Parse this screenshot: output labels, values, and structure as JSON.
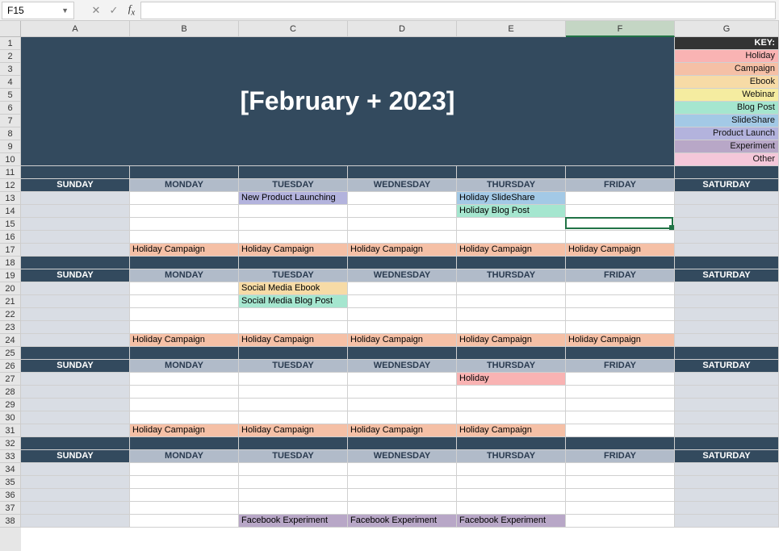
{
  "name_box": "F15",
  "formula_value": "",
  "title": "[February + 2023]",
  "columns": [
    "A",
    "B",
    "C",
    "D",
    "E",
    "F",
    "G"
  ],
  "active_col": "F",
  "row_count": 38,
  "key_header": "KEY:",
  "key_items": [
    {
      "label": "Holiday",
      "cls": "c-holiday"
    },
    {
      "label": "Campaign",
      "cls": "c-campaign"
    },
    {
      "label": "Ebook",
      "cls": "c-ebook"
    },
    {
      "label": "Webinar",
      "cls": "c-webinar"
    },
    {
      "label": "Blog Post",
      "cls": "c-blogpost"
    },
    {
      "label": "SlideShare",
      "cls": "c-slideshare"
    },
    {
      "label": "Product Launch",
      "cls": "c-prodlaunch"
    },
    {
      "label": "Experiment",
      "cls": "c-experiment"
    },
    {
      "label": "Other",
      "cls": "c-other"
    }
  ],
  "days": [
    "SUNDAY",
    "MONDAY",
    "TUESDAY",
    "WEDNESDAY",
    "THURSDAY",
    "FRIDAY",
    "SATURDAY"
  ],
  "weeks": [
    {
      "day_row": 12,
      "body_start": 13,
      "body_end": 17,
      "entries": [
        {
          "row": 13,
          "col": "C",
          "text": "New Product Launching",
          "cls": "c-prodlaunch"
        },
        {
          "row": 13,
          "col": "E",
          "text": "Holiday SlideShare",
          "cls": "c-slideshare"
        },
        {
          "row": 14,
          "col": "E",
          "text": "Holiday Blog Post",
          "cls": "c-blogpost"
        },
        {
          "row": 17,
          "col": "B",
          "text": "Holiday Campaign",
          "cls": "c-campaign"
        },
        {
          "row": 17,
          "col": "C",
          "text": "Holiday Campaign",
          "cls": "c-campaign"
        },
        {
          "row": 17,
          "col": "D",
          "text": "Holiday Campaign",
          "cls": "c-campaign"
        },
        {
          "row": 17,
          "col": "E",
          "text": "Holiday Campaign",
          "cls": "c-campaign"
        },
        {
          "row": 17,
          "col": "F",
          "text": "Holiday Campaign",
          "cls": "c-campaign"
        }
      ]
    },
    {
      "day_row": 19,
      "body_start": 20,
      "body_end": 24,
      "entries": [
        {
          "row": 20,
          "col": "C",
          "text": "Social Media Ebook",
          "cls": "c-ebook"
        },
        {
          "row": 21,
          "col": "C",
          "text": "Social Media Blog Post",
          "cls": "c-blogpost"
        },
        {
          "row": 24,
          "col": "B",
          "text": "Holiday Campaign",
          "cls": "c-campaign"
        },
        {
          "row": 24,
          "col": "C",
          "text": "Holiday Campaign",
          "cls": "c-campaign"
        },
        {
          "row": 24,
          "col": "D",
          "text": "Holiday Campaign",
          "cls": "c-campaign"
        },
        {
          "row": 24,
          "col": "E",
          "text": "Holiday Campaign",
          "cls": "c-campaign"
        },
        {
          "row": 24,
          "col": "F",
          "text": "Holiday Campaign",
          "cls": "c-campaign"
        }
      ]
    },
    {
      "day_row": 26,
      "body_start": 27,
      "body_end": 31,
      "entries": [
        {
          "row": 27,
          "col": "E",
          "text": "Holiday",
          "cls": "c-holiday"
        },
        {
          "row": 31,
          "col": "B",
          "text": "Holiday Campaign",
          "cls": "c-campaign"
        },
        {
          "row": 31,
          "col": "C",
          "text": "Holiday Campaign",
          "cls": "c-campaign"
        },
        {
          "row": 31,
          "col": "D",
          "text": "Holiday Campaign",
          "cls": "c-campaign"
        },
        {
          "row": 31,
          "col": "E",
          "text": "Holiday Campaign",
          "cls": "c-campaign"
        }
      ]
    },
    {
      "day_row": 33,
      "body_start": 34,
      "body_end": 38,
      "entries": [
        {
          "row": 38,
          "col": "C",
          "text": "Facebook Experiment",
          "cls": "c-experiment"
        },
        {
          "row": 38,
          "col": "D",
          "text": "Facebook Experiment",
          "cls": "c-experiment"
        },
        {
          "row": 38,
          "col": "E",
          "text": "Facebook Experiment",
          "cls": "c-experiment"
        }
      ]
    }
  ],
  "active_cell": {
    "row": 15,
    "col": "F"
  }
}
